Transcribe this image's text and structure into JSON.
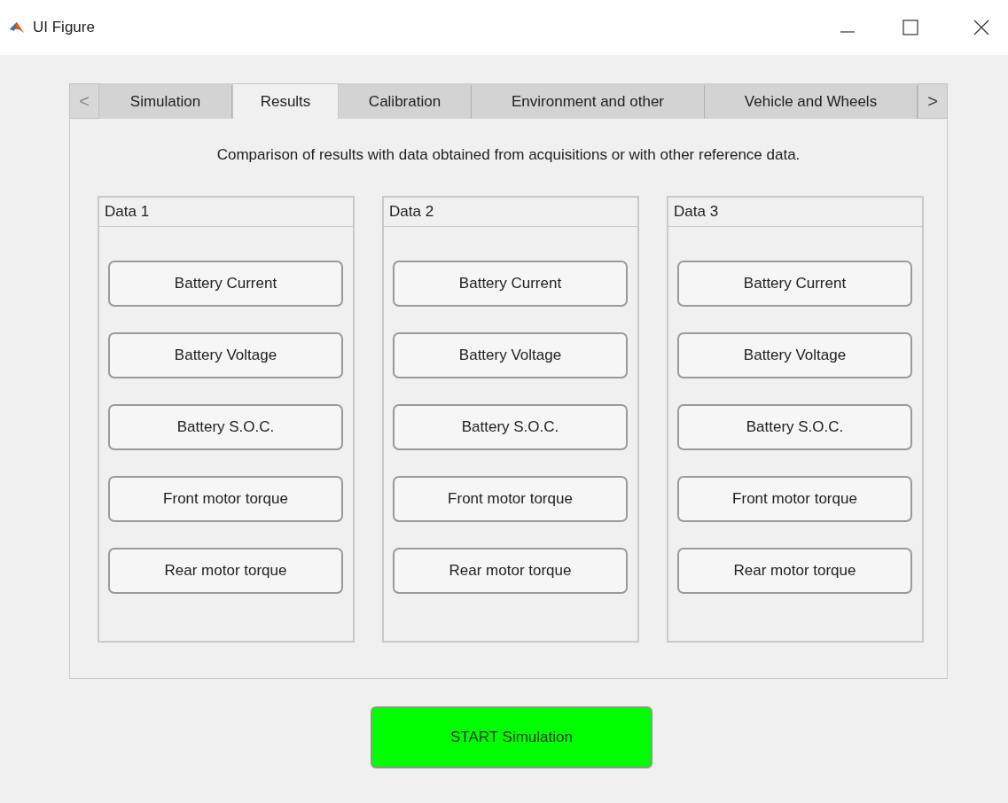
{
  "window": {
    "title": "UI Figure"
  },
  "tab_scroll": {
    "left": {
      "glyph": "<",
      "disabled": true
    },
    "right": {
      "glyph": ">",
      "disabled": false
    }
  },
  "tabs": [
    {
      "label": "Simulation",
      "selected": false
    },
    {
      "label": "Results",
      "selected": true
    },
    {
      "label": "Calibration",
      "selected": false
    },
    {
      "label": "Environment and other",
      "selected": false
    },
    {
      "label": "Vehicle and Wheels",
      "selected": false
    }
  ],
  "description": "Comparison of results with data obtained from acquisitions or with other reference data.",
  "panels": [
    {
      "title": "Data 1",
      "buttons": [
        "Battery Current",
        "Battery Voltage",
        "Battery S.O.C.",
        "Front motor torque",
        "Rear motor torque"
      ]
    },
    {
      "title": "Data 2",
      "buttons": [
        "Battery Current",
        "Battery Voltage",
        "Battery S.O.C.",
        "Front motor torque",
        "Rear motor torque"
      ]
    },
    {
      "title": "Data 3",
      "buttons": [
        "Battery Current",
        "Battery Voltage",
        "Battery S.O.C.",
        "Front motor torque",
        "Rear motor torque"
      ]
    }
  ],
  "start_button": {
    "label": "START Simulation",
    "color": "#00ff00"
  }
}
